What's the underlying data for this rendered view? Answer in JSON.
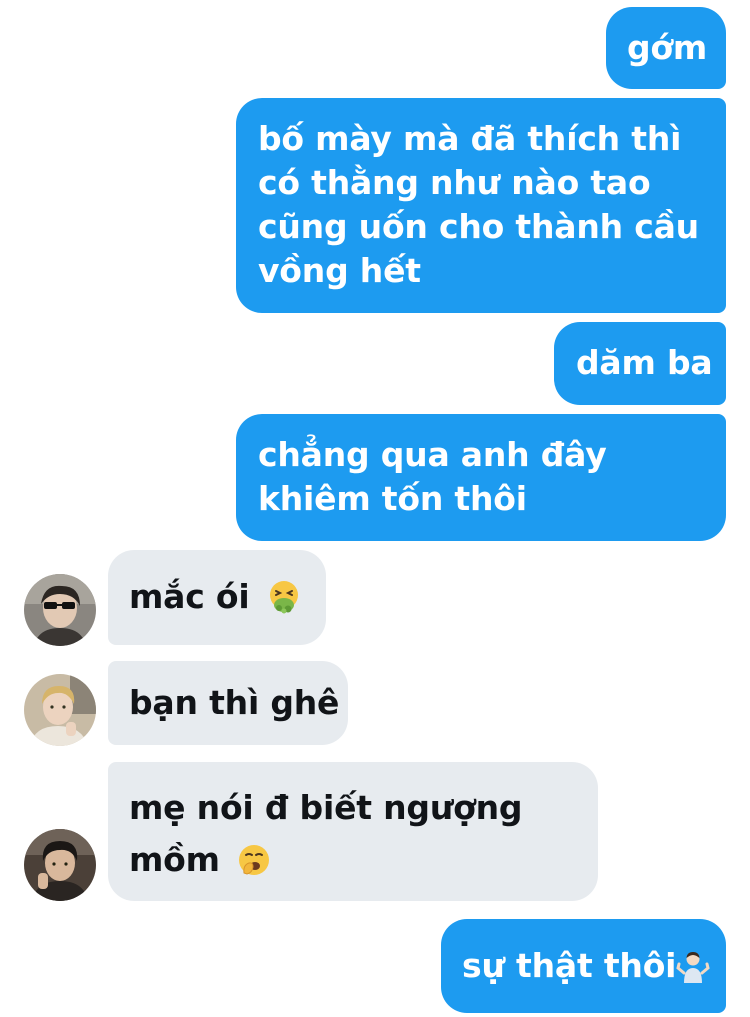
{
  "messages": [
    {
      "id": "m1",
      "direction": "outgoing",
      "lines": [
        "gớm"
      ]
    },
    {
      "id": "m2",
      "direction": "outgoing",
      "lines": [
        "bố mày mà đã thích thì",
        "có thằng như nào tao",
        "cũng uốn cho thành cầu",
        "vồng hết"
      ]
    },
    {
      "id": "m3",
      "direction": "outgoing",
      "lines": [
        "dăm ba"
      ]
    },
    {
      "id": "m4",
      "direction": "outgoing",
      "lines": [
        "chẳng qua anh đây",
        "khiêm tốn thôi"
      ]
    },
    {
      "id": "m5",
      "direction": "incoming",
      "lines": [
        "mắc ói"
      ],
      "emoji": "vomiting-face-icon"
    },
    {
      "id": "m6",
      "direction": "incoming",
      "lines": [
        "bạn thì ghê"
      ]
    },
    {
      "id": "m7",
      "direction": "incoming",
      "lines": [
        "mẹ nói đ biết ngượng",
        "mồm"
      ],
      "emoji": "yawning-face-icon"
    },
    {
      "id": "m8",
      "direction": "outgoing",
      "lines": [
        "sự thật thôi"
      ],
      "emoji": "person-shrugging-icon"
    }
  ],
  "colors": {
    "outgoing_bubble": "#1d9bf0",
    "incoming_bubble": "#e7ebef",
    "outgoing_text": "#ffffff",
    "incoming_text": "#111418",
    "background": "#ffffff"
  }
}
